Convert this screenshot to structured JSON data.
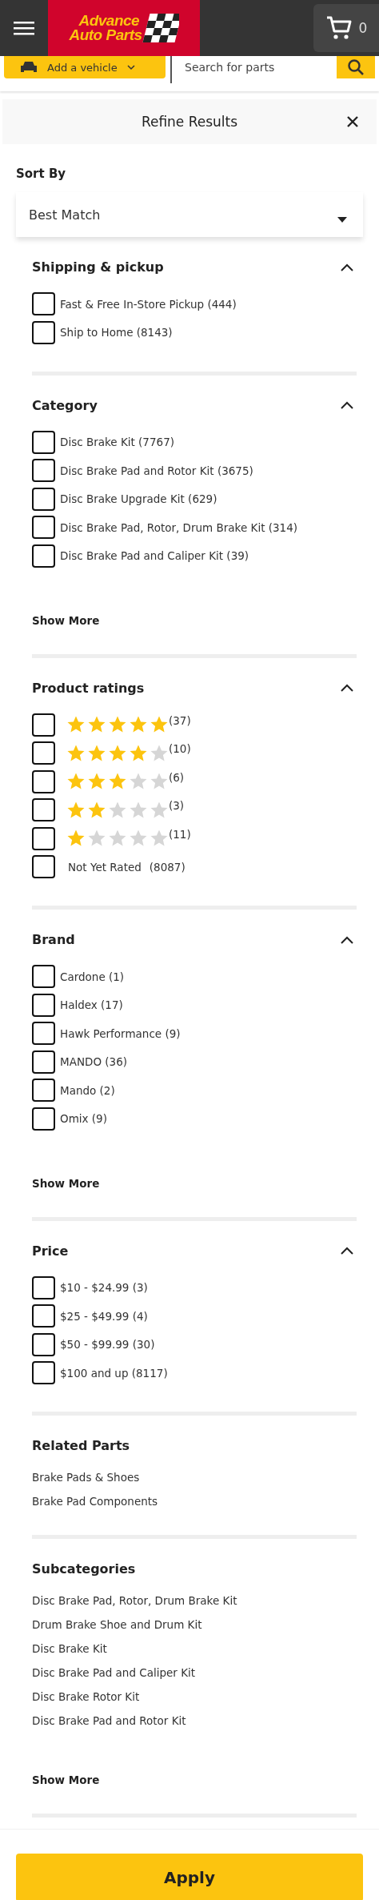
{
  "header": {
    "logo": {
      "line_1": "Advance",
      "line_2": "Auto Parts"
    },
    "cart_count": "0"
  },
  "vehicle_button": {
    "label": "Add a vehicle"
  },
  "search": {
    "placeholder": "Search for parts"
  },
  "panel": {
    "title": "Refine Results"
  },
  "sort": {
    "label": "Sort By",
    "value": "Best Match"
  },
  "sections": [
    {
      "kind": "checkboxes",
      "title": "Shipping & pickup",
      "expanded": true,
      "options": [
        {
          "label": "Fast & Free In-Store Pickup (444)",
          "checked": false
        },
        {
          "label": "Ship to Home (8143)",
          "checked": false
        }
      ]
    },
    {
      "kind": "checkboxes",
      "title": "Category",
      "expanded": true,
      "options": [
        {
          "label": "Disc Brake Kit (7767)",
          "checked": false
        },
        {
          "label": "Disc Brake Pad and Rotor Kit (3675)",
          "checked": false
        },
        {
          "label": "Disc Brake Upgrade Kit (629)",
          "checked": false
        },
        {
          "label": "Disc Brake Pad, Rotor, Drum Brake Kit (314)",
          "checked": false
        },
        {
          "label": "Disc Brake Pad and Caliper Kit (39)",
          "checked": false
        }
      ],
      "show_more": "Show More"
    },
    {
      "kind": "ratings",
      "title": "Product ratings",
      "expanded": true,
      "options": [
        {
          "stars": 5,
          "count": "(37)",
          "checked": false
        },
        {
          "stars": 4,
          "count": "(10)",
          "checked": false
        },
        {
          "stars": 3,
          "count": "(6)",
          "checked": false
        },
        {
          "stars": 2,
          "count": "(3)",
          "checked": false
        },
        {
          "stars": 1,
          "count": "(11)",
          "checked": false
        },
        {
          "label": "Not Yet Rated",
          "count": "(8087)",
          "checked": false
        }
      ]
    },
    {
      "kind": "checkboxes",
      "title": "Brand",
      "expanded": true,
      "options": [
        {
          "label": "Cardone (1)",
          "checked": false
        },
        {
          "label": "Haldex (17)",
          "checked": false
        },
        {
          "label": "Hawk Performance (9)",
          "checked": false
        },
        {
          "label": "MANDO (36)",
          "checked": false
        },
        {
          "label": "Mando (2)",
          "checked": false
        },
        {
          "label": "Omix (9)",
          "checked": false
        }
      ],
      "show_more": "Show More"
    },
    {
      "kind": "checkboxes",
      "title": "Price",
      "expanded": true,
      "options": [
        {
          "label": "$10 - $24.99 (3)",
          "checked": false
        },
        {
          "label": "$25 - $49.99 (4)",
          "checked": false
        },
        {
          "label": "$50 - $99.99 (30)",
          "checked": false
        },
        {
          "label": "$100 and up (8117)",
          "checked": false
        }
      ]
    },
    {
      "kind": "links",
      "title": "Related Parts",
      "links": [
        "Brake Pads & Shoes",
        "Brake Pad Components"
      ]
    },
    {
      "kind": "links",
      "title": "Subcategories",
      "links": [
        "Disc Brake Pad, Rotor, Drum Brake Kit",
        "Drum Brake Shoe and Drum Kit",
        "Disc Brake Kit",
        "Disc Brake Pad and Caliper Kit",
        "Disc Brake Rotor Kit",
        "Disc Brake Pad and Rotor Kit"
      ],
      "show_more": "Show More"
    }
  ],
  "apply_button": "Apply"
}
